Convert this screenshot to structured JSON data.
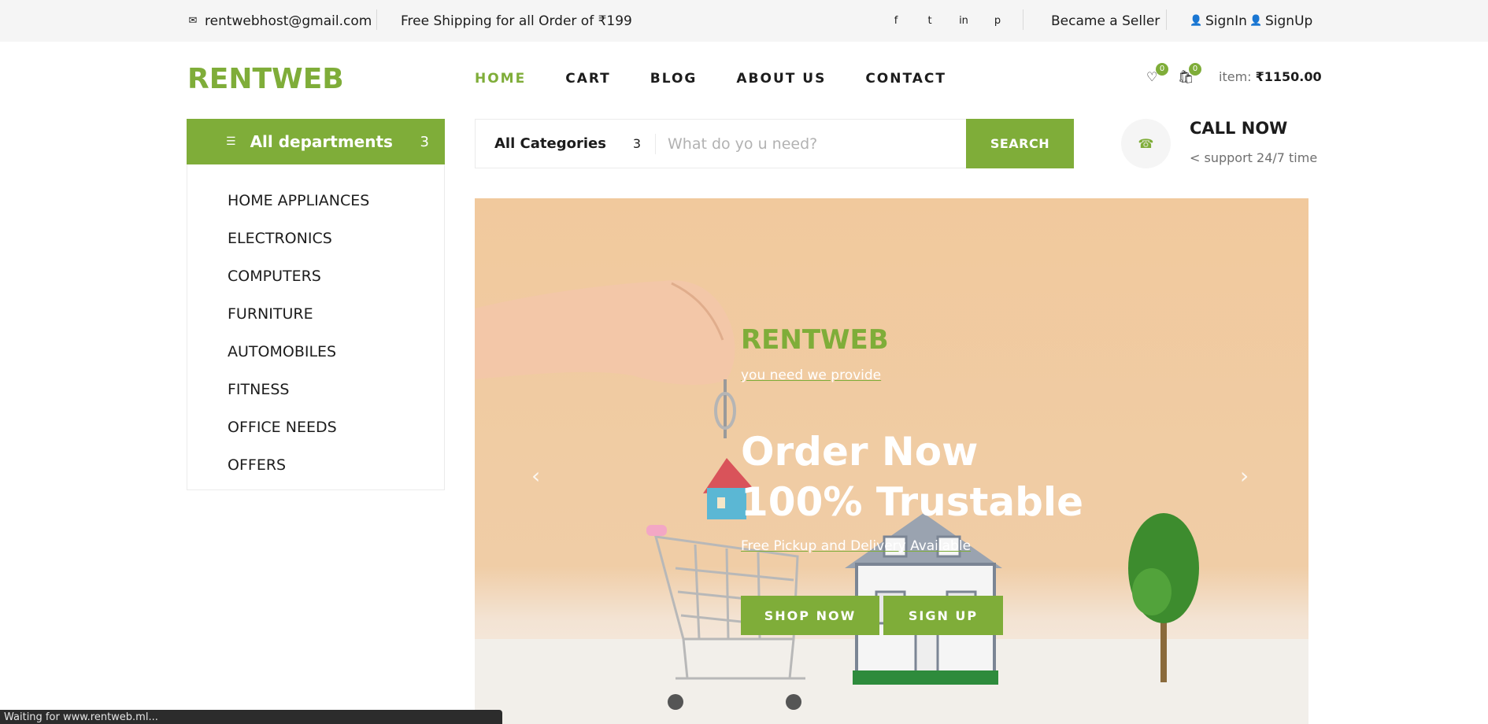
{
  "topbar": {
    "email": "rentwebhost@gmail.com",
    "shipping": "Free Shipping for all Order of ₹199",
    "social_icons": [
      "facebook-icon",
      "twitter-icon",
      "linkedin-icon",
      "pinterest-icon"
    ],
    "seller": "Became a Seller",
    "signin": "SignIn",
    "signup": "SignUp"
  },
  "header": {
    "logo": "RENTWEB",
    "nav": [
      "HOME",
      "CART",
      "BLOG",
      "ABOUT US",
      "CONTACT"
    ],
    "active_nav": "HOME",
    "wishlist_count": "0",
    "cart_count": "0",
    "item_label": "item:",
    "item_total": "₹1150.00"
  },
  "departments": {
    "title": "All departments",
    "arrow": "3",
    "items": [
      "HOME APPLIANCES",
      "ELECTRONICS",
      "COMPUTERS",
      "FURNITURE",
      "AUTOMOBILES",
      "FITNESS",
      "OFFICE NEEDS",
      "OFFERS"
    ]
  },
  "search": {
    "category": "All Categories",
    "category_arrow": "3",
    "placeholder": "What do yo u need?",
    "button": "SEARCH"
  },
  "contact": {
    "title": "CALL NOW",
    "subtitle": "< support 24/7 time"
  },
  "hero": {
    "brand": "RENTWEB",
    "tagline": "you need we provide",
    "headline_1": "Order Now",
    "headline_2": "100% Trustable",
    "subline": "Free Pickup and Delivery Available",
    "shop_button": "SHOP NOW",
    "signup_button": "SIGN UP"
  },
  "status_bar": "Waiting for www.rentweb.ml...",
  "colors": {
    "accent": "#7fad39",
    "text": "#1c1c1c",
    "muted": "#6f6f6f",
    "topbar_bg": "#f5f5f5"
  }
}
